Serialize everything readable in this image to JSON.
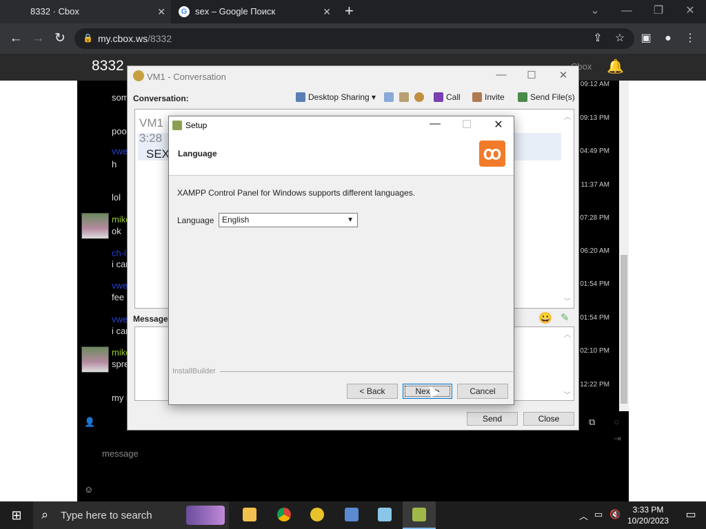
{
  "browser": {
    "tabs": [
      {
        "label": "8332 · Cbox"
      },
      {
        "label": "sex – Google Поиск"
      }
    ],
    "url_host": "my.cbox.ws",
    "url_path": "/8332"
  },
  "site": {
    "room_name": "8332",
    "brand": "Cbox",
    "message_placeholder": "message"
  },
  "chat": {
    "messages": [
      {
        "name": "",
        "text": "som",
        "time": "09:12 AM"
      },
      {
        "name": "",
        "text": "poo",
        "time": "09:13 PM"
      },
      {
        "name": "vwe",
        "text": "h",
        "time": "04:49 PM"
      },
      {
        "name": "",
        "text": "lol",
        "time": "11:37 AM"
      },
      {
        "name": "mike",
        "text": "ok",
        "time": "07:28 PM"
      },
      {
        "name": "ch-l",
        "text": "i car",
        "time": "06:20 AM"
      },
      {
        "name": "vwe",
        "text": "fee a",
        "time": "01:54 PM"
      },
      {
        "name": "vwe",
        "text": "i car",
        "time": "01:54 PM"
      },
      {
        "name": "mike",
        "text": "spre",
        "time": "02:10 PM"
      },
      {
        "name": "",
        "text": "my i",
        "time": "12:22 PM"
      }
    ]
  },
  "conversation": {
    "title": "VM1 - Conversation",
    "label": "Conversation:",
    "toolbar": {
      "desktop_sharing": "Desktop Sharing",
      "call": "Call",
      "invite": "Invite",
      "send_files": "Send File(s)"
    },
    "transcript": {
      "line1": "VM1",
      "line2": "3:28",
      "line3": "SEX"
    },
    "message_label": "Message",
    "send": "Send",
    "close": "Close"
  },
  "setup": {
    "title": "Setup",
    "header": "Language",
    "description": "XAMPP Control Panel for Windows supports different languages.",
    "language_label": "Language",
    "language_value": "English",
    "footer": "InstallBuilder",
    "back": "< Back",
    "next": "Next >",
    "cancel": "Cancel"
  },
  "taskbar": {
    "search_placeholder": "Type here to search",
    "time": "3:33 PM",
    "date": "10/20/2023"
  },
  "colors": {
    "chrome_bg": "#202124",
    "accent_orange": "#f27b2a",
    "chat_name_green": "#9acd32",
    "chat_name_blue": "#2a3fd8"
  }
}
